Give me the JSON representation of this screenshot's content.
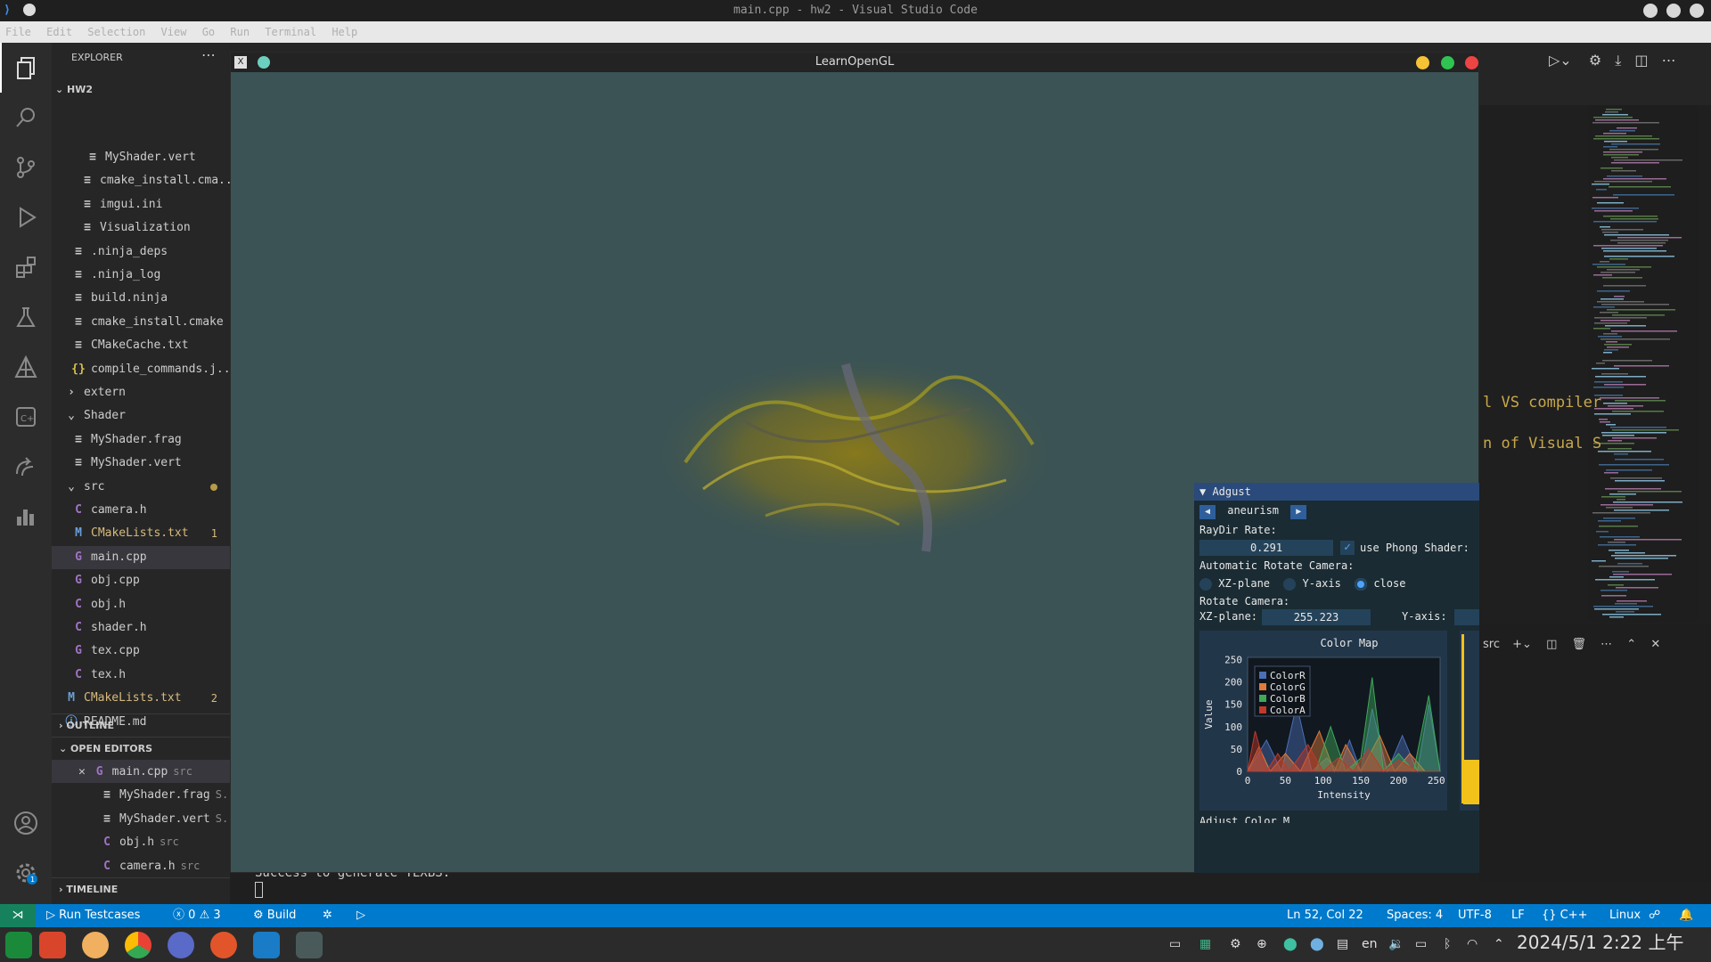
{
  "window": {
    "title": "main.cpp - hw2 - Visual Studio Code"
  },
  "menu": [
    "File",
    "Edit",
    "Selection",
    "View",
    "Go",
    "Run",
    "Terminal",
    "Help"
  ],
  "explorer": {
    "header": "EXPLORER",
    "root": "HW2",
    "items": [
      {
        "label": "MyShader.vert",
        "icon": "lines-icon"
      },
      {
        "label": "cmake_install.cma...",
        "icon": "lines-icon"
      },
      {
        "label": "imgui.ini",
        "icon": "lines-icon"
      },
      {
        "label": "Visualization",
        "icon": "lines-icon"
      },
      {
        "label": ".ninja_deps",
        "icon": "lines-icon"
      },
      {
        "label": ".ninja_log",
        "icon": "lines-icon"
      },
      {
        "label": "build.ninja",
        "icon": "lines-icon"
      },
      {
        "label": "cmake_install.cmake",
        "icon": "lines-icon"
      },
      {
        "label": "CMakeCache.txt",
        "icon": "lines-icon"
      },
      {
        "label": "compile_commands.j...",
        "icon": "braces-icon"
      },
      {
        "label": "extern",
        "icon": "chevron-right-icon"
      },
      {
        "label": "Shader",
        "icon": "chevron-down-icon"
      },
      {
        "label": "MyShader.frag",
        "icon": "lines-icon"
      },
      {
        "label": "MyShader.vert",
        "icon": "lines-icon"
      },
      {
        "label": "src",
        "icon": "chevron-down-icon"
      },
      {
        "label": "camera.h",
        "icon": "c-icon"
      },
      {
        "label": "CMakeLists.txt",
        "icon": "m-icon",
        "badge": "1"
      },
      {
        "label": "main.cpp",
        "icon": "cpp-icon"
      },
      {
        "label": "obj.cpp",
        "icon": "cpp-icon"
      },
      {
        "label": "obj.h",
        "icon": "c-icon"
      },
      {
        "label": "shader.h",
        "icon": "c-icon"
      },
      {
        "label": "tex.cpp",
        "icon": "cpp-icon"
      },
      {
        "label": "tex.h",
        "icon": "c-icon"
      },
      {
        "label": "CMakeLists.txt",
        "icon": "m-icon",
        "badge": "2"
      },
      {
        "label": "README.md",
        "icon": "info-icon"
      }
    ],
    "outline": "OUTLINE",
    "open_editors": "OPEN EDITORS",
    "open_files": [
      {
        "label": "main.cpp",
        "dir": "src"
      },
      {
        "label": "MyShader.frag",
        "dir": "S..."
      },
      {
        "label": "MyShader.vert",
        "dir": "S..."
      },
      {
        "label": "obj.h",
        "dir": "src"
      },
      {
        "label": "camera.h",
        "dir": "src"
      }
    ],
    "timeline": "TIMELINE"
  },
  "glwindow": {
    "title": "LearnOpenGL"
  },
  "panel": {
    "header": "Adgust",
    "dataset": "aneurism",
    "raydir_label": "RayDir Rate:",
    "raydir_value": "0.291",
    "phong_label": "use Phong Shader:",
    "phong_checked": true,
    "auto_rotate_label": "Automatic Rotate Camera:",
    "radio_options": [
      "XZ-plane",
      "Y-axis",
      "close"
    ],
    "radio_selected": "close",
    "rotate_label": "Rotate Camera:",
    "xz_label": "XZ-plane:",
    "xz_value": "255.223",
    "y_label": "Y-axis:",
    "next_label": "Adjust Color M..."
  },
  "chart_data": {
    "type": "area",
    "title": "Color Map",
    "xlabel": "Intensity",
    "ylabel": "Value",
    "xlim": [
      0,
      255
    ],
    "ylim": [
      0,
      255
    ],
    "xticks": [
      0,
      50,
      100,
      150,
      200,
      250
    ],
    "yticks": [
      0,
      50,
      100,
      150,
      200,
      250
    ],
    "legend": "top-left",
    "series": [
      {
        "name": "ColorR",
        "color": "#4a6fb5",
        "x": [
          0,
          25,
          45,
          65,
          85,
          105,
          120,
          135,
          150,
          165,
          185,
          205,
          225,
          240,
          255
        ],
        "y": [
          0,
          70,
          0,
          150,
          0,
          30,
          0,
          70,
          0,
          140,
          0,
          80,
          0,
          150,
          0
        ]
      },
      {
        "name": "ColorG",
        "color": "#e07b3a",
        "x": [
          0,
          15,
          30,
          50,
          70,
          95,
          115,
          130,
          150,
          175,
          195,
          215,
          235,
          255
        ],
        "y": [
          0,
          55,
          0,
          40,
          0,
          90,
          0,
          60,
          0,
          80,
          0,
          40,
          0,
          0
        ]
      },
      {
        "name": "ColorB",
        "color": "#3fa85a",
        "x": [
          0,
          90,
          110,
          130,
          150,
          165,
          180,
          200,
          220,
          240,
          255
        ],
        "y": [
          0,
          0,
          100,
          0,
          30,
          210,
          0,
          40,
          0,
          170,
          0
        ]
      },
      {
        "name": "ColorA",
        "color": "#c0392b",
        "x": [
          0,
          10,
          25,
          40,
          55,
          80,
          100,
          120,
          140,
          160,
          180,
          200,
          225,
          255
        ],
        "y": [
          0,
          90,
          0,
          40,
          0,
          60,
          0,
          30,
          0,
          50,
          0,
          25,
          0,
          0
        ]
      }
    ]
  },
  "terminal": {
    "path": "src",
    "text": "Success to generate TEXBS."
  },
  "editor_text": [
    "l VS compiler",
    "n of Visual S"
  ],
  "status": {
    "run": "Run Testcases",
    "errors": "0",
    "warnings": "3",
    "build": "Build",
    "position": "Ln 52, Col 22",
    "spaces": "Spaces: 4",
    "encoding": "UTF-8",
    "eol": "LF",
    "lang": "{} C++",
    "os": "Linux"
  },
  "taskbar": {
    "lang": "en",
    "datetime": "2024/5/1  2:22  上午"
  },
  "colors": {
    "accent": "#007acc",
    "gl_bg": "#3b5355",
    "panel_bg": "#1a2b33",
    "panel_header": "#294a7a"
  }
}
